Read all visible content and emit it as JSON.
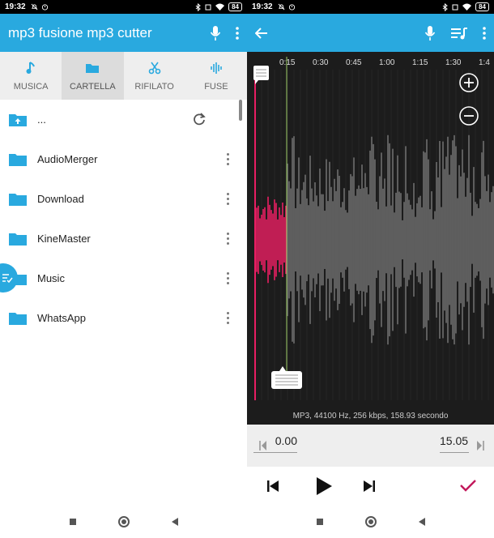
{
  "left": {
    "status": {
      "time": "19:32",
      "battery": "84"
    },
    "app_title": "mp3 fusione mp3 cutter",
    "tabs": [
      {
        "label": "MUSICA",
        "icon": "music-note-icon"
      },
      {
        "label": "CARTELLA",
        "icon": "folder-icon"
      },
      {
        "label": "RIFILATO",
        "icon": "scissors-icon"
      },
      {
        "label": "FUSE",
        "icon": "waveform-icon"
      }
    ],
    "up_item": "...",
    "folders": [
      "AudioMerger",
      "Download",
      "KineMaster",
      "Music",
      "WhatsApp"
    ]
  },
  "right": {
    "status": {
      "time": "19:32",
      "battery": "84"
    },
    "timeline_labels": [
      "0:15",
      "0:30",
      "0:45",
      "1:00",
      "1:15",
      "1:30",
      "1:4"
    ],
    "file_info": "MP3, 44100 Hz, 256 kbps, 158.93 secondo",
    "start_time": "0.00",
    "end_time": "15.05"
  },
  "colors": {
    "accent": "#29a9df",
    "selection": "#e91e63",
    "confirm": "#c2185b",
    "waveform_bg": "#1c1c1c"
  }
}
